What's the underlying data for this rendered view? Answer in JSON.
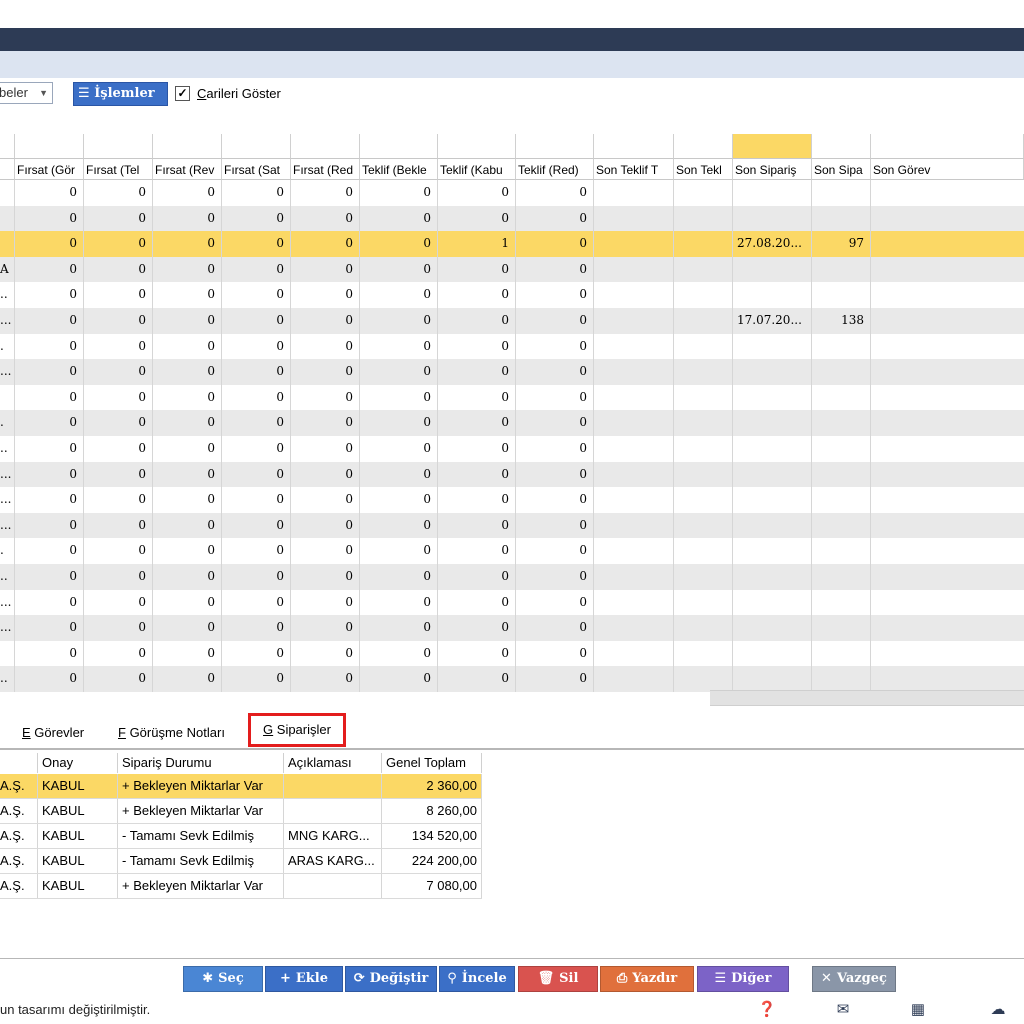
{
  "colors": {
    "accent": "#3b6fc7",
    "selected_row": "#fbd865",
    "header_bar": "#2d3b55"
  },
  "toolbar": {
    "combo_value": "beler",
    "islemler_label": "İşlemler",
    "show_label_first": "C",
    "show_label_rest": "arileri Göster",
    "checkbox_mark": "✓"
  },
  "grid": {
    "columns": [
      "Fırsat (Gör",
      "Fırsat (Tel",
      "Fırsat (Rev",
      "Fırsat (Sat",
      "Fırsat (Red",
      "Teklif (Bekle",
      "Teklif (Kabu",
      "Teklif (Red)",
      "Son Teklif T",
      "Son Tekl",
      "Son Sipariş ",
      "Son Sipa",
      "Son Görev"
    ],
    "rows": [
      {
        "lead": "",
        "v": [
          "0",
          "0",
          "0",
          "0",
          "0",
          "0",
          "0",
          "0"
        ],
        "sip_date": "",
        "sip_no": ""
      },
      {
        "lead": "",
        "v": [
          "0",
          "0",
          "0",
          "0",
          "0",
          "0",
          "0",
          "0"
        ],
        "sip_date": "",
        "sip_no": ""
      },
      {
        "lead": "",
        "v": [
          "0",
          "0",
          "0",
          "0",
          "0",
          "0",
          "1",
          "0"
        ],
        "sip_date": "27.08.20...",
        "sip_no": "97"
      },
      {
        "lead": "A",
        "v": [
          "0",
          "0",
          "0",
          "0",
          "0",
          "0",
          "0",
          "0"
        ],
        "sip_date": "",
        "sip_no": ""
      },
      {
        "lead": "..",
        "v": [
          "0",
          "0",
          "0",
          "0",
          "0",
          "0",
          "0",
          "0"
        ],
        "sip_date": "",
        "sip_no": ""
      },
      {
        "lead": "...",
        "v": [
          "0",
          "0",
          "0",
          "0",
          "0",
          "0",
          "0",
          "0"
        ],
        "sip_date": "17.07.20...",
        "sip_no": "138"
      },
      {
        "lead": ".",
        "v": [
          "0",
          "0",
          "0",
          "0",
          "0",
          "0",
          "0",
          "0"
        ],
        "sip_date": "",
        "sip_no": ""
      },
      {
        "lead": "...",
        "v": [
          "0",
          "0",
          "0",
          "0",
          "0",
          "0",
          "0",
          "0"
        ],
        "sip_date": "",
        "sip_no": ""
      },
      {
        "lead": "",
        "v": [
          "0",
          "0",
          "0",
          "0",
          "0",
          "0",
          "0",
          "0"
        ],
        "sip_date": "",
        "sip_no": ""
      },
      {
        "lead": ".",
        "v": [
          "0",
          "0",
          "0",
          "0",
          "0",
          "0",
          "0",
          "0"
        ],
        "sip_date": "",
        "sip_no": ""
      },
      {
        "lead": "..",
        "v": [
          "0",
          "0",
          "0",
          "0",
          "0",
          "0",
          "0",
          "0"
        ],
        "sip_date": "",
        "sip_no": ""
      },
      {
        "lead": "...",
        "v": [
          "0",
          "0",
          "0",
          "0",
          "0",
          "0",
          "0",
          "0"
        ],
        "sip_date": "",
        "sip_no": ""
      },
      {
        "lead": "...",
        "v": [
          "0",
          "0",
          "0",
          "0",
          "0",
          "0",
          "0",
          "0"
        ],
        "sip_date": "",
        "sip_no": ""
      },
      {
        "lead": "...",
        "v": [
          "0",
          "0",
          "0",
          "0",
          "0",
          "0",
          "0",
          "0"
        ],
        "sip_date": "",
        "sip_no": ""
      },
      {
        "lead": ".",
        "v": [
          "0",
          "0",
          "0",
          "0",
          "0",
          "0",
          "0",
          "0"
        ],
        "sip_date": "",
        "sip_no": ""
      },
      {
        "lead": "..",
        "v": [
          "0",
          "0",
          "0",
          "0",
          "0",
          "0",
          "0",
          "0"
        ],
        "sip_date": "",
        "sip_no": ""
      },
      {
        "lead": "...",
        "v": [
          "0",
          "0",
          "0",
          "0",
          "0",
          "0",
          "0",
          "0"
        ],
        "sip_date": "",
        "sip_no": ""
      },
      {
        "lead": "...",
        "v": [
          "0",
          "0",
          "0",
          "0",
          "0",
          "0",
          "0",
          "0"
        ],
        "sip_date": "",
        "sip_no": ""
      },
      {
        "lead": "",
        "v": [
          "0",
          "0",
          "0",
          "0",
          "0",
          "0",
          "0",
          "0"
        ],
        "sip_date": "",
        "sip_no": ""
      },
      {
        "lead": "..",
        "v": [
          "0",
          "0",
          "0",
          "0",
          "0",
          "0",
          "0",
          "0"
        ],
        "sip_date": "",
        "sip_no": ""
      }
    ]
  },
  "tabs": {
    "gorevler_key": "E",
    "gorevler_rest": " Görevler",
    "notlar_key": "F",
    "notlar_rest": " Görüşme Notları",
    "siparisler_key": "G",
    "siparisler_rest": " Siparişler"
  },
  "orders": {
    "headers": [
      "Onay",
      "Sipariş Durumu",
      "Açıklaması",
      "Genel Toplam"
    ],
    "rows": [
      {
        "lead": "A.Ş.",
        "onay": "KABUL",
        "durum": "+ Bekleyen Miktarlar Var",
        "aciklama": "",
        "toplam": "2 360,00"
      },
      {
        "lead": "A.Ş.",
        "onay": "KABUL",
        "durum": "+ Bekleyen Miktarlar Var",
        "aciklama": "",
        "toplam": "8 260,00"
      },
      {
        "lead": "A.Ş.",
        "onay": "KABUL",
        "durum": "- Tamamı Sevk Edilmiş",
        "aciklama": "MNG KARG...",
        "toplam": "134 520,00"
      },
      {
        "lead": "A.Ş.",
        "onay": "KABUL",
        "durum": "- Tamamı Sevk Edilmiş",
        "aciklama": "ARAS KARG...",
        "toplam": "224 200,00"
      },
      {
        "lead": "A.Ş.",
        "onay": "KABUL",
        "durum": "+ Bekleyen Miktarlar Var",
        "aciklama": "",
        "toplam": "7 080,00"
      }
    ]
  },
  "buttons": [
    {
      "label": "Seç",
      "icon": "✱",
      "color": "#4a86d4"
    },
    {
      "label": "Ekle",
      "icon": "+",
      "color": "#3b6fc7"
    },
    {
      "label": "Değiştir",
      "icon": "⟳",
      "color": "#3b6fc7"
    },
    {
      "label": "İncele",
      "icon": "⚲",
      "color": "#3b6fc7"
    },
    {
      "label": "Sil",
      "icon": "🗑",
      "color": "#d9534f"
    },
    {
      "label": "Yazdır",
      "icon": "⎙",
      "color": "#e0703c"
    },
    {
      "label": "Diğer",
      "icon": "☰",
      "color": "#7c63c7"
    },
    {
      "label": "Vazgeç",
      "icon": "✕",
      "color": "#8a96a8"
    }
  ],
  "status": {
    "text": "un tasarımı değiştirilmiştir."
  }
}
